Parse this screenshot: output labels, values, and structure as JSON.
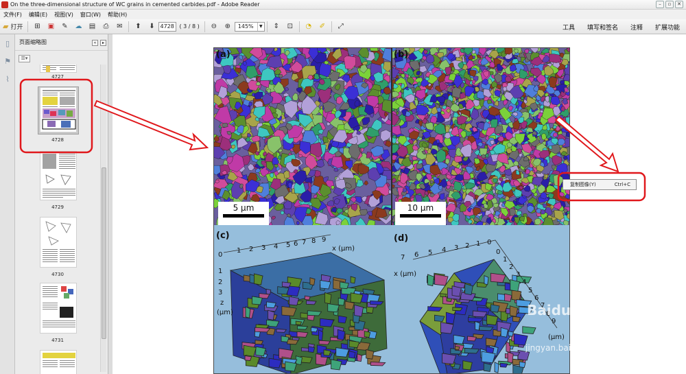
{
  "window": {
    "title": "On the three-dimensional structure of WC grains in cemented carbides.pdf - Adobe Reader"
  },
  "menu": [
    "文件(F)",
    "编辑(E)",
    "视图(V)",
    "窗口(W)",
    "帮助(H)"
  ],
  "toolbar": {
    "open_label": "打开",
    "page_value": "4728",
    "page_count": "( 3 / 8 )",
    "zoom_value": "145%",
    "right_links": [
      "工具",
      "填写和签名",
      "注释",
      "扩展功能"
    ]
  },
  "panel": {
    "title": "页面缩略图",
    "thumbnails": [
      {
        "label": "4727"
      },
      {
        "label": "4728",
        "selected": true
      },
      {
        "label": "4729"
      },
      {
        "label": "4730"
      },
      {
        "label": "4731"
      }
    ]
  },
  "figure": {
    "panels": [
      "(a)",
      "(b)",
      "(c)",
      "(d)"
    ],
    "scalebars": [
      "5 μm",
      "10 μm"
    ],
    "axis_c_x_ticks": [
      "1",
      "2",
      "3",
      "4",
      "5",
      "6",
      "7",
      "8",
      "9"
    ],
    "axis_c_x_label": "x (μm)",
    "axis_c_z_ticks": [
      "0",
      "1",
      "2",
      "3"
    ],
    "axis_c_z_label": "z",
    "axis_c_z_unit": "(μm)",
    "axis_d_x_ticks": [
      "7",
      "6",
      "5",
      "4",
      "3",
      "2",
      "1",
      "0"
    ],
    "axis_d_x_label": "x (μm)",
    "axis_d_right_ticks": [
      "0",
      "1",
      "2",
      "3",
      "4",
      "5",
      "6",
      "7",
      "8",
      "9"
    ],
    "axis_d_right_unit": "(μm)"
  },
  "context_menu": {
    "item_label": "复制图像(Y)",
    "shortcut": "Ctrl+C"
  },
  "watermark": {
    "brand": "Baidu 经验",
    "url": "jingyan.baidu.com"
  },
  "colors": {
    "annotation_red": "#e0181c",
    "figure_bg": "#96bedc"
  }
}
